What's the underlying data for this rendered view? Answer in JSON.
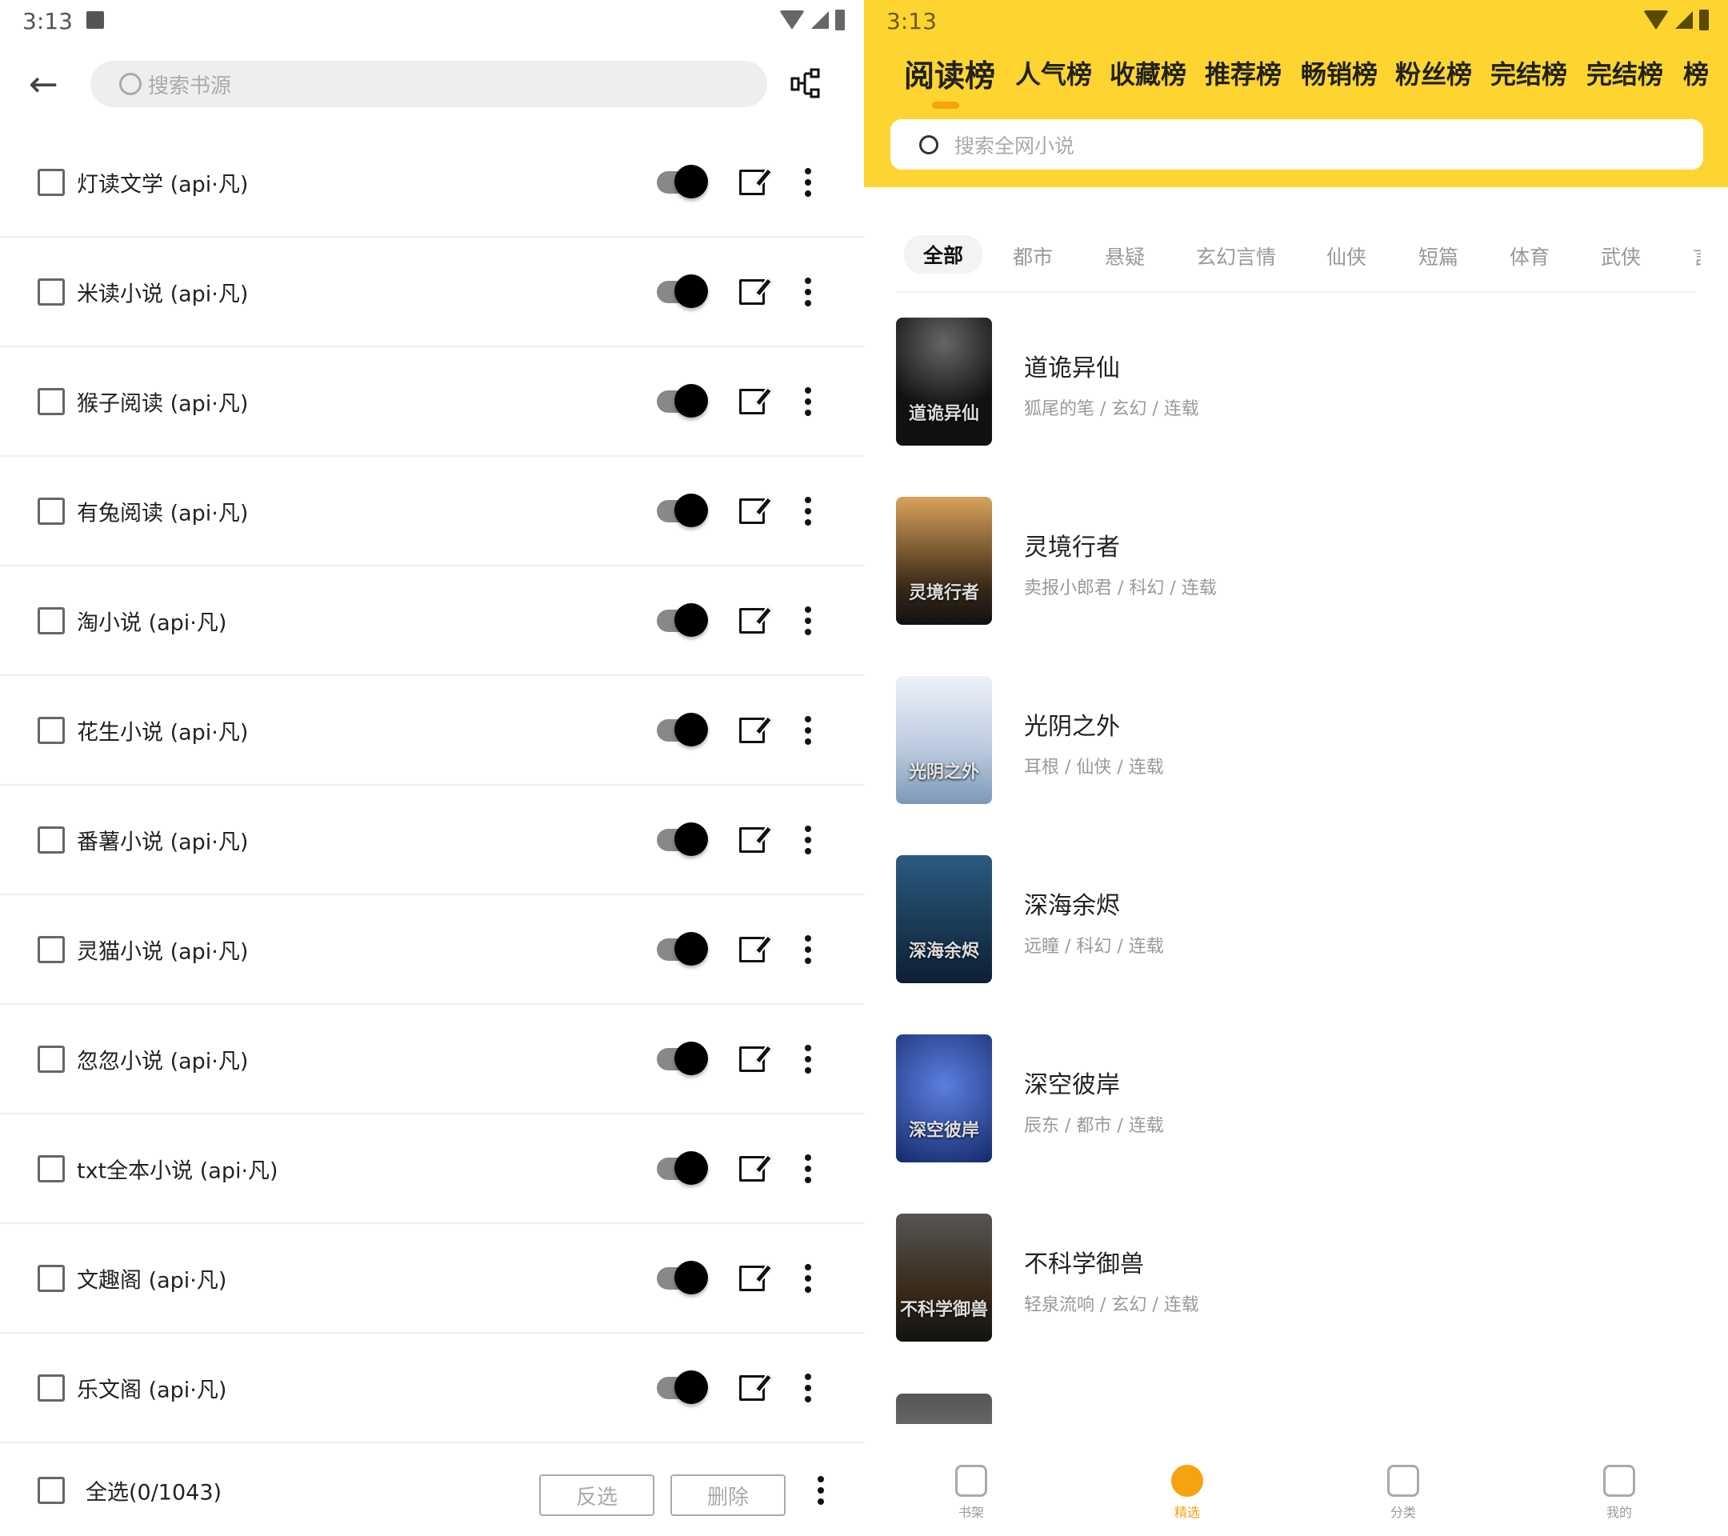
{
  "left": {
    "status": {
      "time": "3:13"
    },
    "search_placeholder": "搜索书源",
    "sources": [
      {
        "name": "灯读文学 (api·凡)",
        "enabled": true,
        "checked": false
      },
      {
        "name": "米读小说 (api·凡)",
        "enabled": true,
        "checked": false
      },
      {
        "name": "猴子阅读 (api·凡)",
        "enabled": true,
        "checked": false
      },
      {
        "name": "有兔阅读 (api·凡)",
        "enabled": true,
        "checked": false
      },
      {
        "name": "淘小说 (api·凡)",
        "enabled": true,
        "checked": false
      },
      {
        "name": "花生小说 (api·凡)",
        "enabled": true,
        "checked": false
      },
      {
        "name": "番薯小说 (api·凡)",
        "enabled": true,
        "checked": false
      },
      {
        "name": "灵猫小说 (api·凡)",
        "enabled": true,
        "checked": false
      },
      {
        "name": "忽忽小说 (api·凡)",
        "enabled": true,
        "checked": false
      },
      {
        "name": "txt全本小说 (api·凡)",
        "enabled": true,
        "checked": false
      },
      {
        "name": "文趣阁 (api·凡)",
        "enabled": true,
        "checked": false
      },
      {
        "name": "乐文阁 (api·凡)",
        "enabled": true,
        "checked": false
      }
    ],
    "bottom": {
      "select_all": "全选(0/1043)",
      "invert": "反选",
      "delete": "删除"
    }
  },
  "right": {
    "status": {
      "time": "3:13"
    },
    "accent": "#FED530",
    "highlight": "#F5A30F",
    "rank_tabs": [
      "阅读榜",
      "人气榜",
      "收藏榜",
      "推荐榜",
      "畅销榜",
      "粉丝榜",
      "完结榜",
      "完结榜",
      "榜"
    ],
    "active_rank_tab": 0,
    "search_placeholder": "搜索全网小说",
    "categories": [
      "全部",
      "都市",
      "悬疑",
      "玄幻言情",
      "仙侠",
      "短篇",
      "体育",
      "武侠",
      "言"
    ],
    "active_category": 0,
    "books": [
      {
        "title": "道诡异仙",
        "meta": "狐尾的笔 / 玄幻 / 连载",
        "cover_text": "道诡异仙"
      },
      {
        "title": "灵境行者",
        "meta": "卖报小郎君 / 科幻 / 连载",
        "cover_text": "灵境行者"
      },
      {
        "title": "光阴之外",
        "meta": "耳根 / 仙侠 / 连载",
        "cover_text": "光阴之外"
      },
      {
        "title": "深海余烬",
        "meta": "远瞳 / 科幻 / 连载",
        "cover_text": "深海余烬"
      },
      {
        "title": "深空彼岸",
        "meta": "辰东 / 都市 / 连载",
        "cover_text": "深空彼岸"
      },
      {
        "title": "不科学御兽",
        "meta": "轻泉流响 / 玄幻 / 连载",
        "cover_text": "不科学御兽"
      }
    ],
    "nav": [
      {
        "label": "书架",
        "icon": "bookshelf-icon"
      },
      {
        "label": "精选",
        "icon": "compass-icon",
        "active": true
      },
      {
        "label": "分类",
        "icon": "category-icon"
      },
      {
        "label": "我的",
        "icon": "profile-icon"
      }
    ]
  }
}
